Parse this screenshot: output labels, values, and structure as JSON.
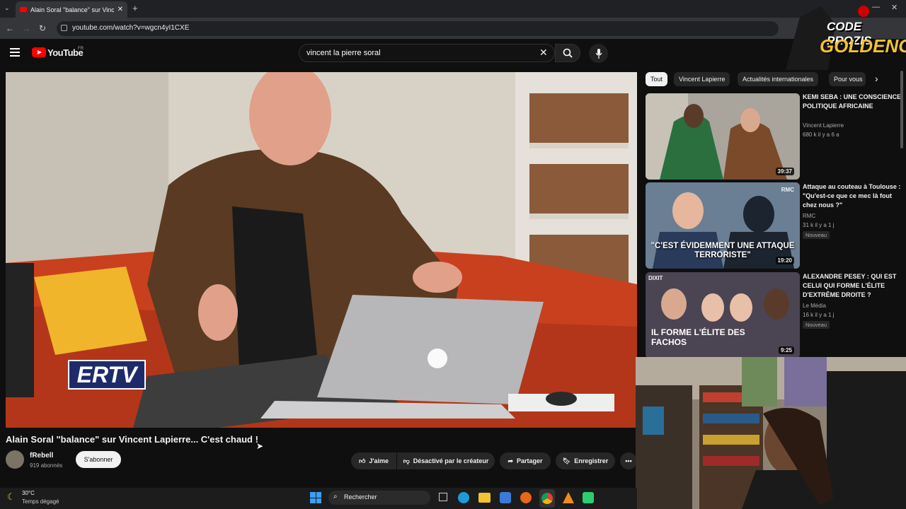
{
  "browser": {
    "tab_title": "Alain Soral \"balance\" sur Vincent Lapierre...",
    "url": "youtube.com/watch?v=wgcn4yI1CXE"
  },
  "youtube": {
    "logo": "YouTube",
    "region": "FR",
    "search_value": "vincent la pierre soral"
  },
  "video": {
    "title": "Alain Soral \"balance\" sur Vincent Lapierre... C'est chaud !",
    "watermark": "ERTV",
    "channel": "fRebell",
    "subscribers": "919 abonnés",
    "subscribe_label": "S'abonner",
    "like_label": "J'aime",
    "dislike_label": "Désactivé par le créateur",
    "share_label": "Partager",
    "save_label": "Enregistrer"
  },
  "chips": [
    "Tout",
    "Vincent Lapierre",
    "Actualités internationales",
    "Pour vous"
  ],
  "related": [
    {
      "title": "KEMI SEBA : UNE CONSCIENCE POLITIQUE AFRICAINE",
      "channel": "Vincent Lapierre",
      "meta": "680 k  il y a 6 a",
      "duration": "39:37",
      "badge": ""
    },
    {
      "title": "Attaque au couteau à Toulouse : \"Qu'est-ce que ce mec là fout chez nous ?\"",
      "channel": "RMC",
      "meta": "31 k  il y a 1 j",
      "duration": "19:20",
      "badge": "Nouveau",
      "thumb_text": "\"C'EST ÉVIDEMMENT UNE ATTAQUE TERRORISTE\"",
      "thumb_tag": "RMC"
    },
    {
      "title": "ALEXANDRE PESEY : QUI EST CELUI QUI FORME L'ÉLITE D'EXTRÊME DROITE ?",
      "channel": "Le Média",
      "meta": "16 k  il y a 1 j",
      "duration": "9:25",
      "badge": "Nouveau",
      "thumb_text": "IL FORME L'ÉLITE DES FACHOS",
      "thumb_tag": "DIXIT"
    }
  ],
  "overlay": {
    "line1": "CODE PROZIS",
    "line2": "GOLDENG"
  },
  "taskbar": {
    "temp": "30°C",
    "weather": "Temps dégagé",
    "search": "Rechercher"
  },
  "colors": {
    "yt_red": "#ff0000",
    "bg": "#0f0f0f"
  }
}
